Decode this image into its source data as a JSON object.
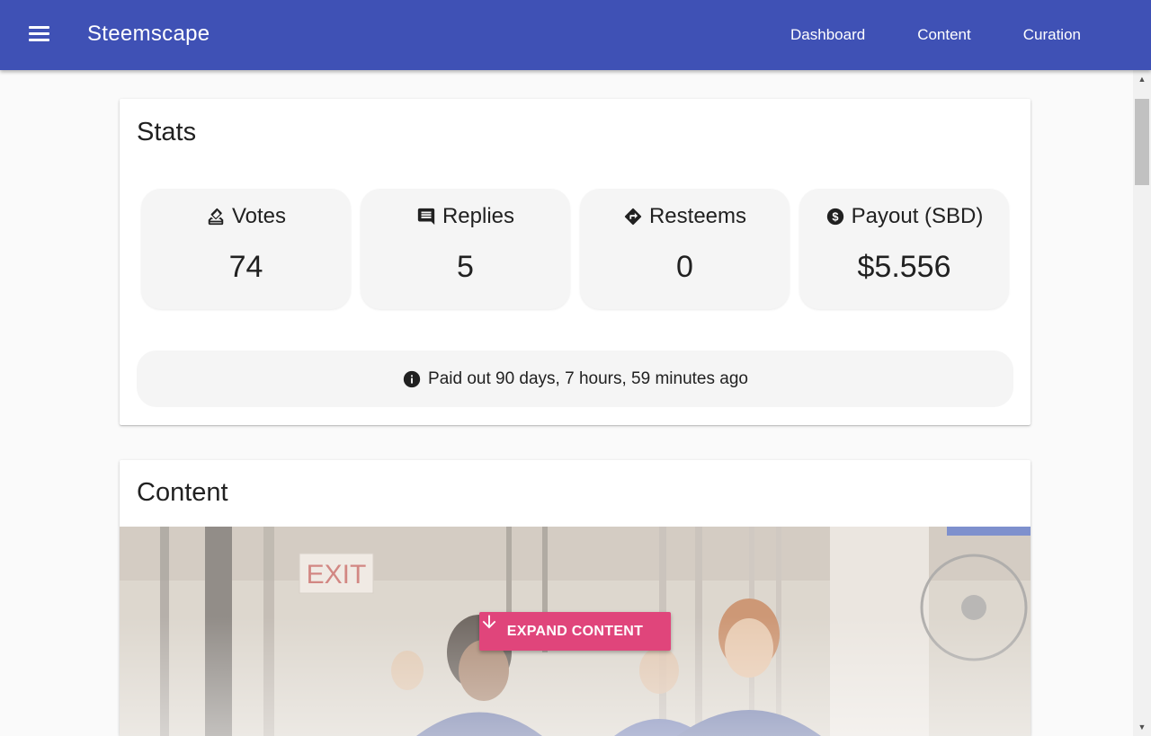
{
  "appbar": {
    "title": "Steemscape",
    "nav": [
      "Dashboard",
      "Content",
      "Curation"
    ],
    "color": "#3f51b5"
  },
  "stats": {
    "title": "Stats",
    "items": [
      {
        "label": "Votes",
        "value": "74",
        "icon": "vote-icon"
      },
      {
        "label": "Replies",
        "value": "5",
        "icon": "comment-icon"
      },
      {
        "label": "Resteems",
        "value": "0",
        "icon": "directions-icon"
      },
      {
        "label": "Payout (SBD)",
        "value": "$5.556",
        "icon": "dollar-circle-icon"
      }
    ],
    "payout_info": "Paid out 90 days, 7 hours, 59 minutes ago"
  },
  "content": {
    "title": "Content",
    "expand_label": "EXPAND CONTENT",
    "image_text": "EXIT",
    "button_color": "#e0457b"
  }
}
